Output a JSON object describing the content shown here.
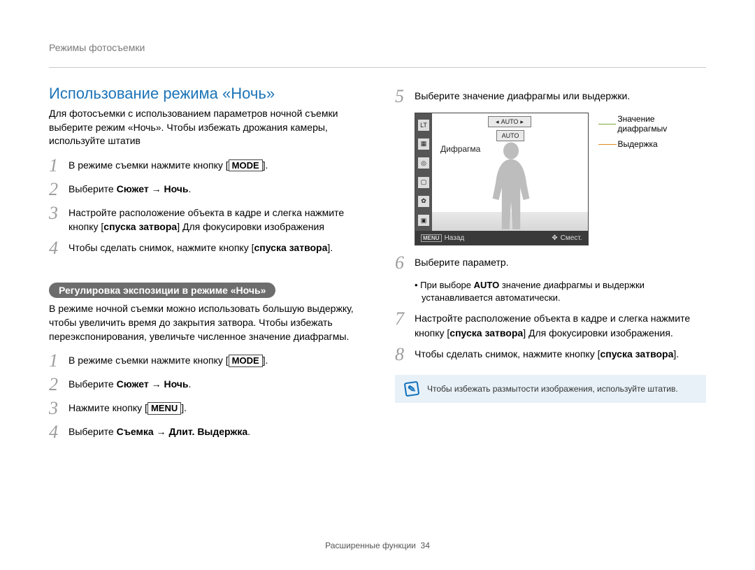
{
  "breadcrumb": "Режимы фотосъемки",
  "section_title": "Использование режима «Ночь»",
  "intro": "Для фотосъемки с использованием параметров ночной съемки выберите режим «Ночь». Чтобы избежать дрожания камеры, используйте штатив",
  "left_steps": [
    {
      "num": "1",
      "text": "В режиме съемки нажмите кнопку [ MODE]."
    },
    {
      "num": "2",
      "text": "Выберите Сюжет → Ночь."
    },
    {
      "num": "3",
      "text": "Настройте расположение объекта в кадре и слегка нажмите кнопку [спуска затвора] Для фокусировки изображения"
    },
    {
      "num": "4",
      "text": "Чтобы сделать снимок, нажмите кнопку [спуска затвора]."
    }
  ],
  "pill_label": "Регулировка экспозиции в режиме «Ночь»",
  "pill_intro": "В режиме ночной съемки можно использовать большую выдержку, чтобы увеличить время до закрытия затвора. Чтобы избежать переэкспонирования, увеличьте численное значение диафрагмы.",
  "left_steps_b": [
    {
      "num": "1",
      "text": "В режиме съемки нажмите кнопку [ MODE]."
    },
    {
      "num": "2",
      "text": "Выберите Сюжет → Ночь."
    },
    {
      "num": "3",
      "text": "Нажмите кнопку [ MENU]."
    },
    {
      "num": "4",
      "text": "Выберите Съемка → Длит. Выдержка."
    }
  ],
  "right_steps_a": [
    {
      "num": "5",
      "text": "Выберите значение диафрагмы или выдержки."
    }
  ],
  "lcd": {
    "lt": "LT",
    "auto1": "AUTO",
    "auto2": "AUTO",
    "aperture_label": "Дифрагма",
    "back": "Назад",
    "move": "Смест."
  },
  "callouts": {
    "aperture": "Значение диафрагмыv",
    "shutter": "Выдержка"
  },
  "right_steps_b": [
    {
      "num": "6",
      "text": "Выберите параметр."
    }
  ],
  "right_sub_bullet": "При выборе AUTO значение диафрагмы и выдержки устанавливается автоматически.",
  "right_steps_c": [
    {
      "num": "7",
      "text": "Настройте расположение объекта в кадре и слегка нажмите кнопку [спуска затвора] Для фокусировки изображения."
    },
    {
      "num": "8",
      "text": "Чтобы сделать снимок, нажмите кнопку [спуска затвора]."
    }
  ],
  "note_text": "Чтобы избежать размытости изображения, используйте штатив.",
  "footer": {
    "label": "Расширенные функции",
    "page": "34"
  },
  "keys": {
    "mode": "MODE",
    "menu": "MENU",
    "menu_small": "MENU"
  },
  "bold_words": {
    "scene_night": "Сюжет → Ночь",
    "shutter_release": "спуска затвора",
    "shoot_long": "Съемка → Длит. Выдержка",
    "auto": "AUTO"
  }
}
